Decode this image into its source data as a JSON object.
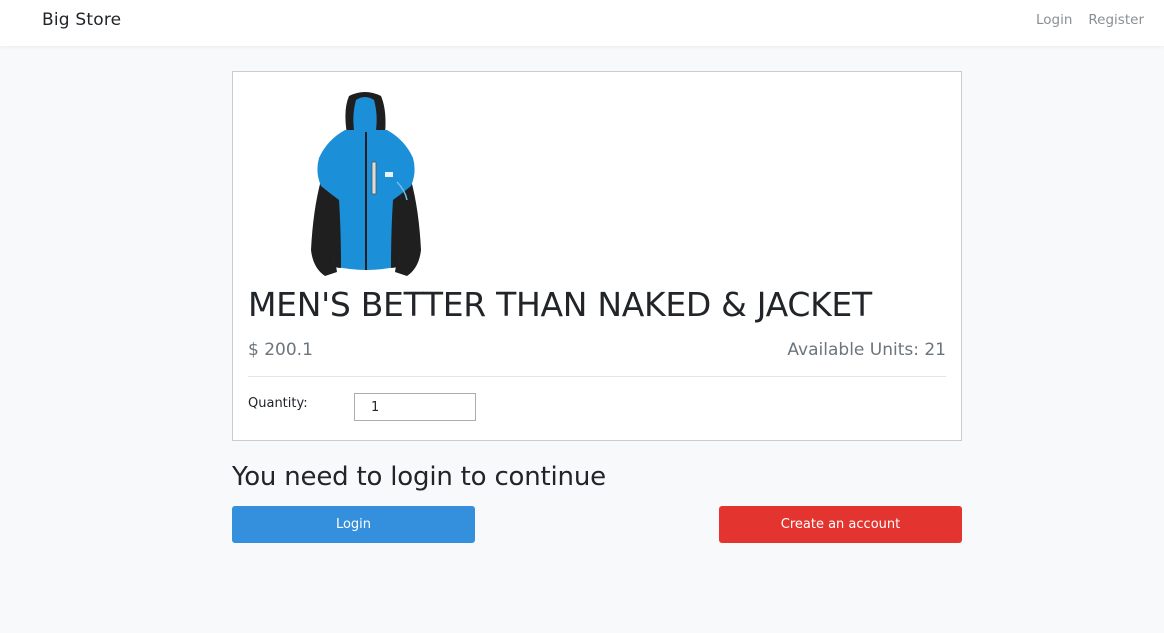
{
  "navbar": {
    "brand": "Big Store",
    "links": [
      "Login",
      "Register"
    ]
  },
  "product": {
    "image_icon": "blue-jacket-image",
    "title": "MEN'S BETTER THAN NAKED & JACKET",
    "price": "$ 200.1",
    "available_units": "Available Units: 21",
    "quantity_label": "Quantity:",
    "quantity_value": "1"
  },
  "auth_prompt": {
    "message": "You need to login to continue",
    "login_label": "Login",
    "create_account_label": "Create an account"
  },
  "colors": {
    "login_button": "#3490dc",
    "create_account_button": "#e3342f",
    "jacket_blue": "#1b8fd8",
    "jacket_black": "#1f1f1f"
  }
}
